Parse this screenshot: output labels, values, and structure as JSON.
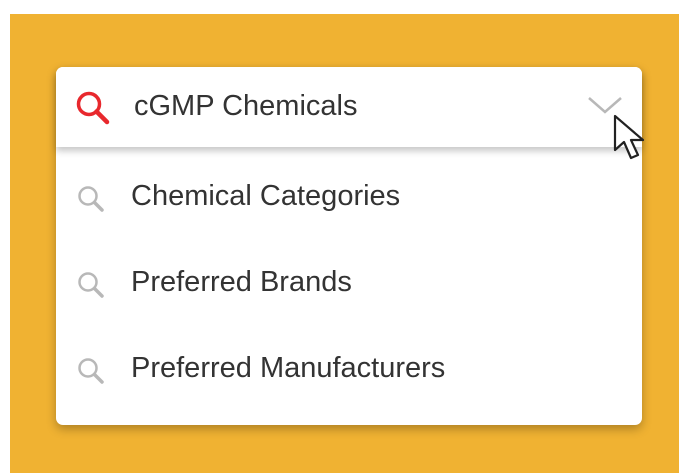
{
  "colors": {
    "background": "#f0b232",
    "accent_icon": "#e8282d",
    "muted_icon": "#b8b8b8",
    "text": "#333333"
  },
  "dropdown": {
    "selected": {
      "label": "cGMP Chemicals",
      "icon": "search-icon",
      "caret_icon": "chevron-down-icon"
    },
    "options": [
      {
        "label": "Chemical Categories",
        "icon": "search-icon"
      },
      {
        "label": "Preferred Brands",
        "icon": "search-icon"
      },
      {
        "label": "Preferred Manufacturers",
        "icon": "search-icon"
      }
    ]
  },
  "pointer": {
    "icon": "mouse-pointer-icon"
  }
}
